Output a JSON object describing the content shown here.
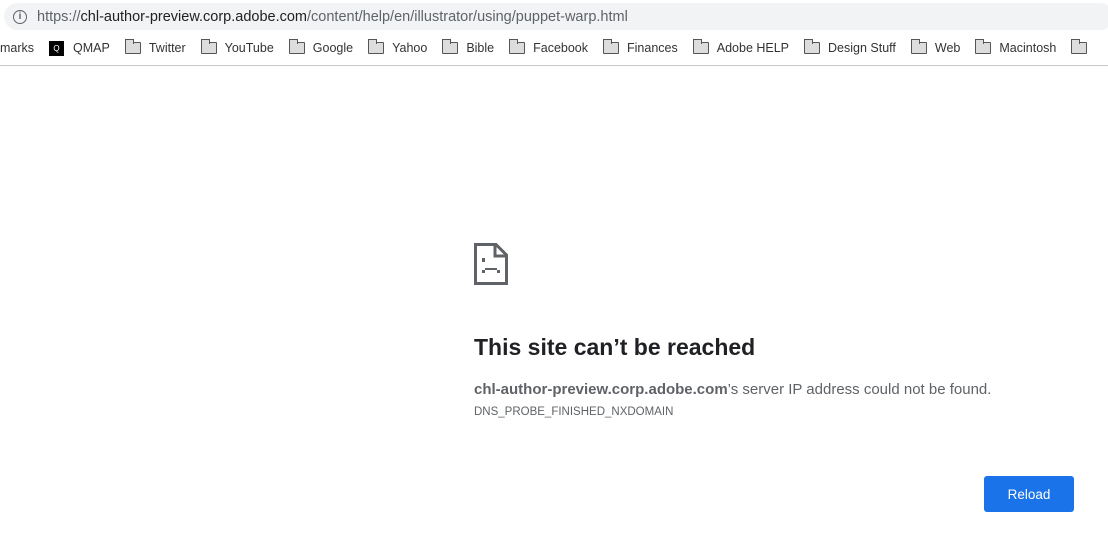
{
  "address_bar": {
    "scheme": "https://",
    "host": "chl-author-preview.corp.adobe.com",
    "path": "/content/help/en/illustrator/using/puppet-warp.html"
  },
  "bookmarks": {
    "partial_label": "marks",
    "items": [
      {
        "label": "QMAP",
        "icon": "qmap-icon",
        "icon_text": "Q"
      },
      {
        "label": "Twitter",
        "icon": "folder-icon"
      },
      {
        "label": "YouTube",
        "icon": "folder-icon"
      },
      {
        "label": "Google",
        "icon": "folder-icon"
      },
      {
        "label": "Yahoo",
        "icon": "folder-icon"
      },
      {
        "label": "Bible",
        "icon": "folder-icon"
      },
      {
        "label": "Facebook",
        "icon": "folder-icon"
      },
      {
        "label": "Finances",
        "icon": "folder-icon"
      },
      {
        "label": "Adobe HELP",
        "icon": "folder-icon"
      },
      {
        "label": "Design Stuff",
        "icon": "folder-icon"
      },
      {
        "label": "Web",
        "icon": "folder-icon"
      },
      {
        "label": "Macintosh",
        "icon": "folder-icon"
      }
    ]
  },
  "error": {
    "title": "This site can’t be reached",
    "host": "chl-author-preview.corp.adobe.com",
    "message": "’s server IP address could not be found.",
    "code": "DNS_PROBE_FINISHED_NXDOMAIN",
    "reload_label": "Reload"
  },
  "colors": {
    "accent": "#1a73e8"
  }
}
